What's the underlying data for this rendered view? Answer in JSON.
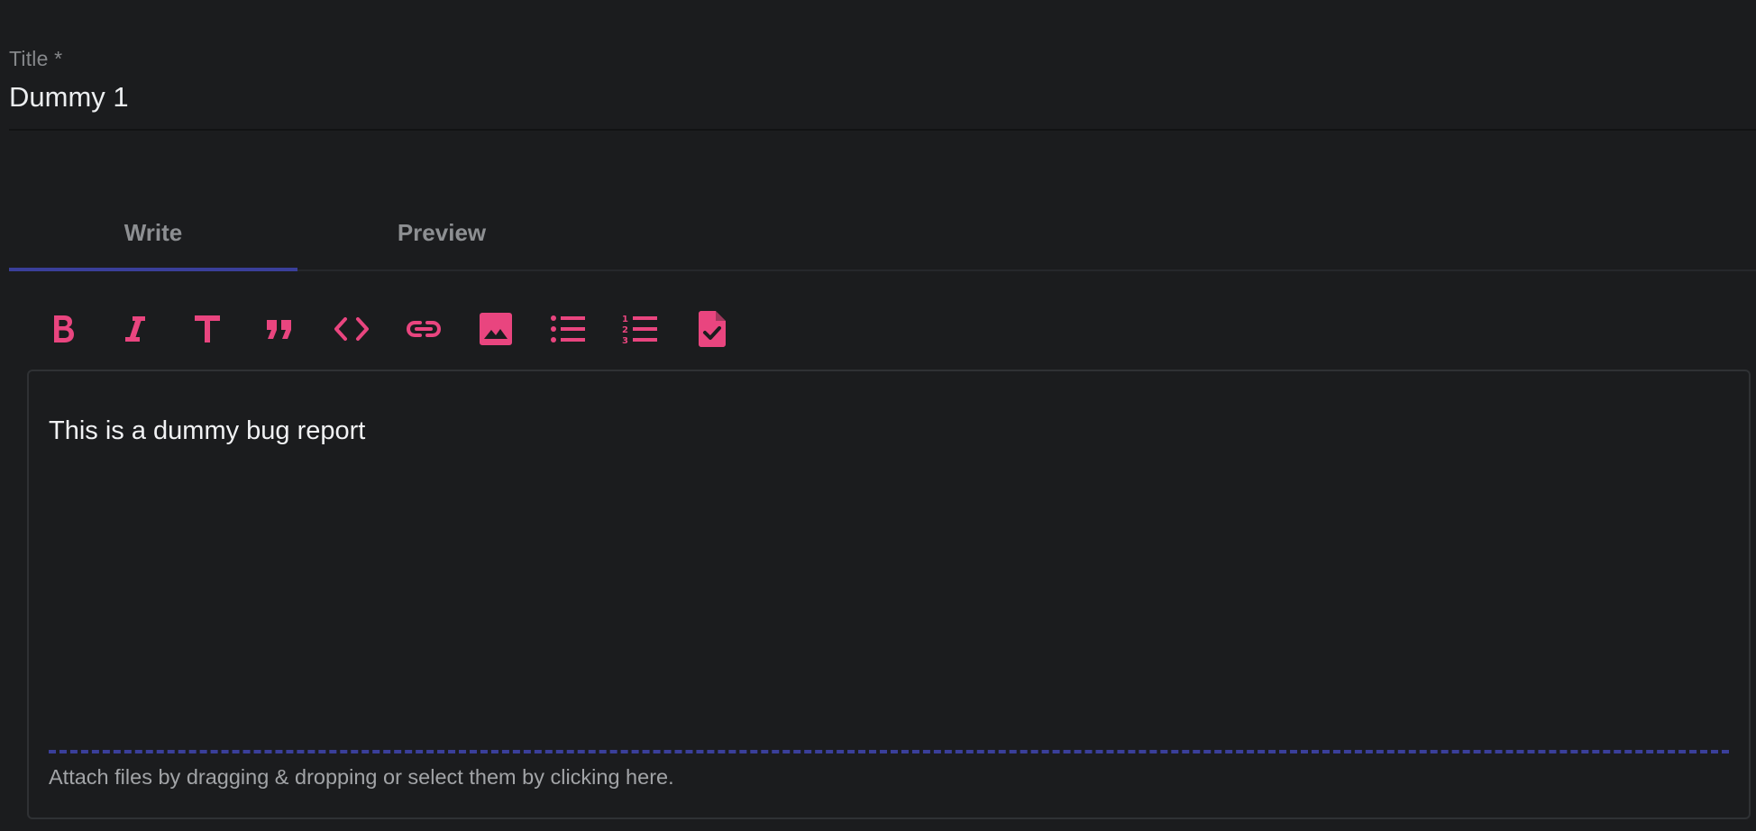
{
  "title_field": {
    "label": "Title *",
    "value": "Dummy 1"
  },
  "tabs": [
    {
      "label": "Write",
      "active": true
    },
    {
      "label": "Preview",
      "active": false
    }
  ],
  "toolbar": {
    "accent_color": "#e9457f",
    "buttons": [
      {
        "icon": "bold-icon"
      },
      {
        "icon": "italic-icon"
      },
      {
        "icon": "heading-icon"
      },
      {
        "icon": "quote-icon"
      },
      {
        "icon": "code-icon"
      },
      {
        "icon": "link-icon"
      },
      {
        "icon": "image-icon"
      },
      {
        "icon": "bulleted-list-icon"
      },
      {
        "icon": "numbered-list-icon"
      },
      {
        "icon": "task-file-icon"
      }
    ]
  },
  "editor": {
    "body": "This is a dummy bug report",
    "attach_hint": "Attach files by dragging & dropping or select them by clicking here."
  },
  "colors": {
    "background": "#1b1c1e",
    "accent": "#e9457f",
    "tab_indicator": "#3a3f9a"
  }
}
